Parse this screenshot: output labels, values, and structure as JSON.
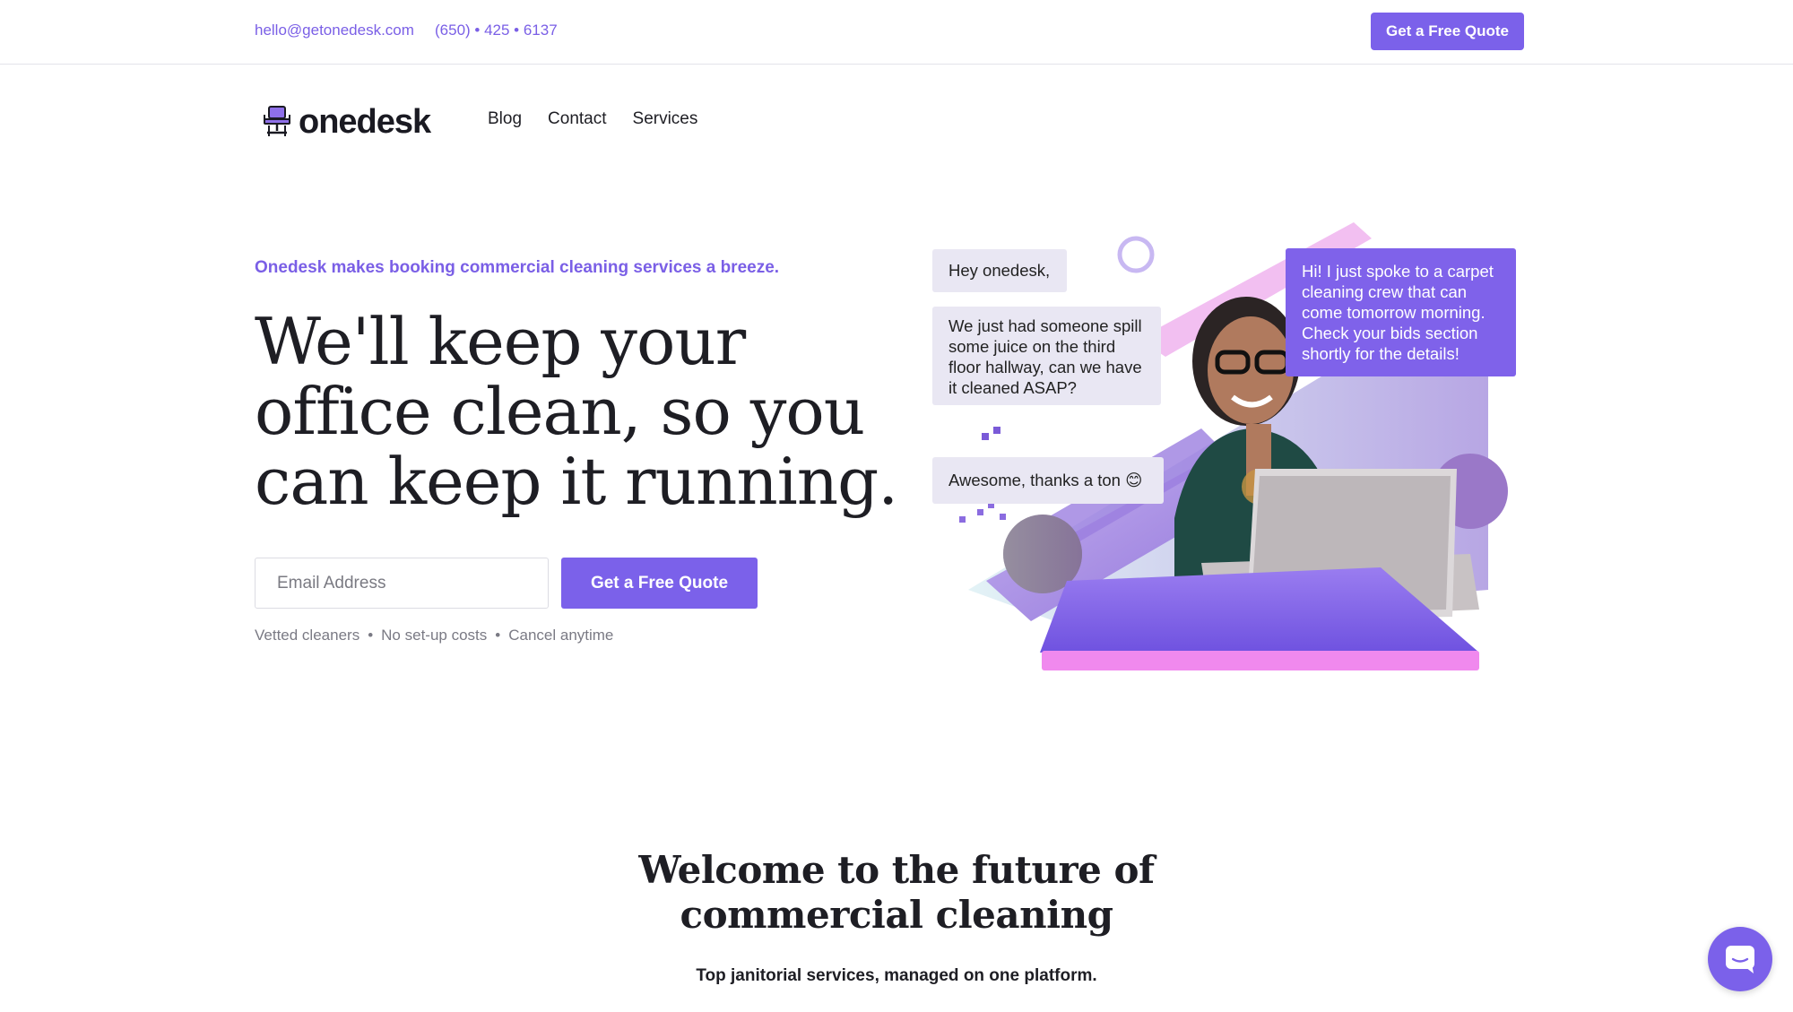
{
  "topbar": {
    "email": "hello@getonedesk.com",
    "phone": "(650) • 425 • 6137",
    "quote_button": "Get a Free Quote"
  },
  "brand": {
    "name": "onedesk",
    "accent_color": "#7b61ea"
  },
  "nav": {
    "items": [
      {
        "label": "Blog"
      },
      {
        "label": "Contact"
      },
      {
        "label": "Services"
      }
    ]
  },
  "hero": {
    "tagline": "Onedesk makes booking commercial cleaning services a breeze.",
    "headline": "We'll keep your office clean, so you can keep it running.",
    "email_placeholder": "Email Address",
    "email_value": "",
    "cta_button": "Get a Free Quote",
    "features": [
      "Vetted cleaners",
      "No set-up costs",
      "Cancel anytime"
    ],
    "separator": "•"
  },
  "chat_illustration": {
    "messages": [
      {
        "from": "user",
        "text": "Hey onedesk,"
      },
      {
        "from": "user",
        "text": "We just had someone spill some juice on the third floor hallway, can we have it cleaned ASAP?"
      },
      {
        "from": "user",
        "text": "Awesome, thanks a ton 😊"
      },
      {
        "from": "bot",
        "text": "Hi! I just spoke to a carpet cleaning crew that can come tomorrow morning. Check your bids section shortly for the details!"
      }
    ]
  },
  "welcome": {
    "title": "Welcome to the future of commercial cleaning",
    "subtitle": "Top janitorial services, managed on one platform."
  },
  "chat_widget": {
    "icon": "chat-icon"
  }
}
